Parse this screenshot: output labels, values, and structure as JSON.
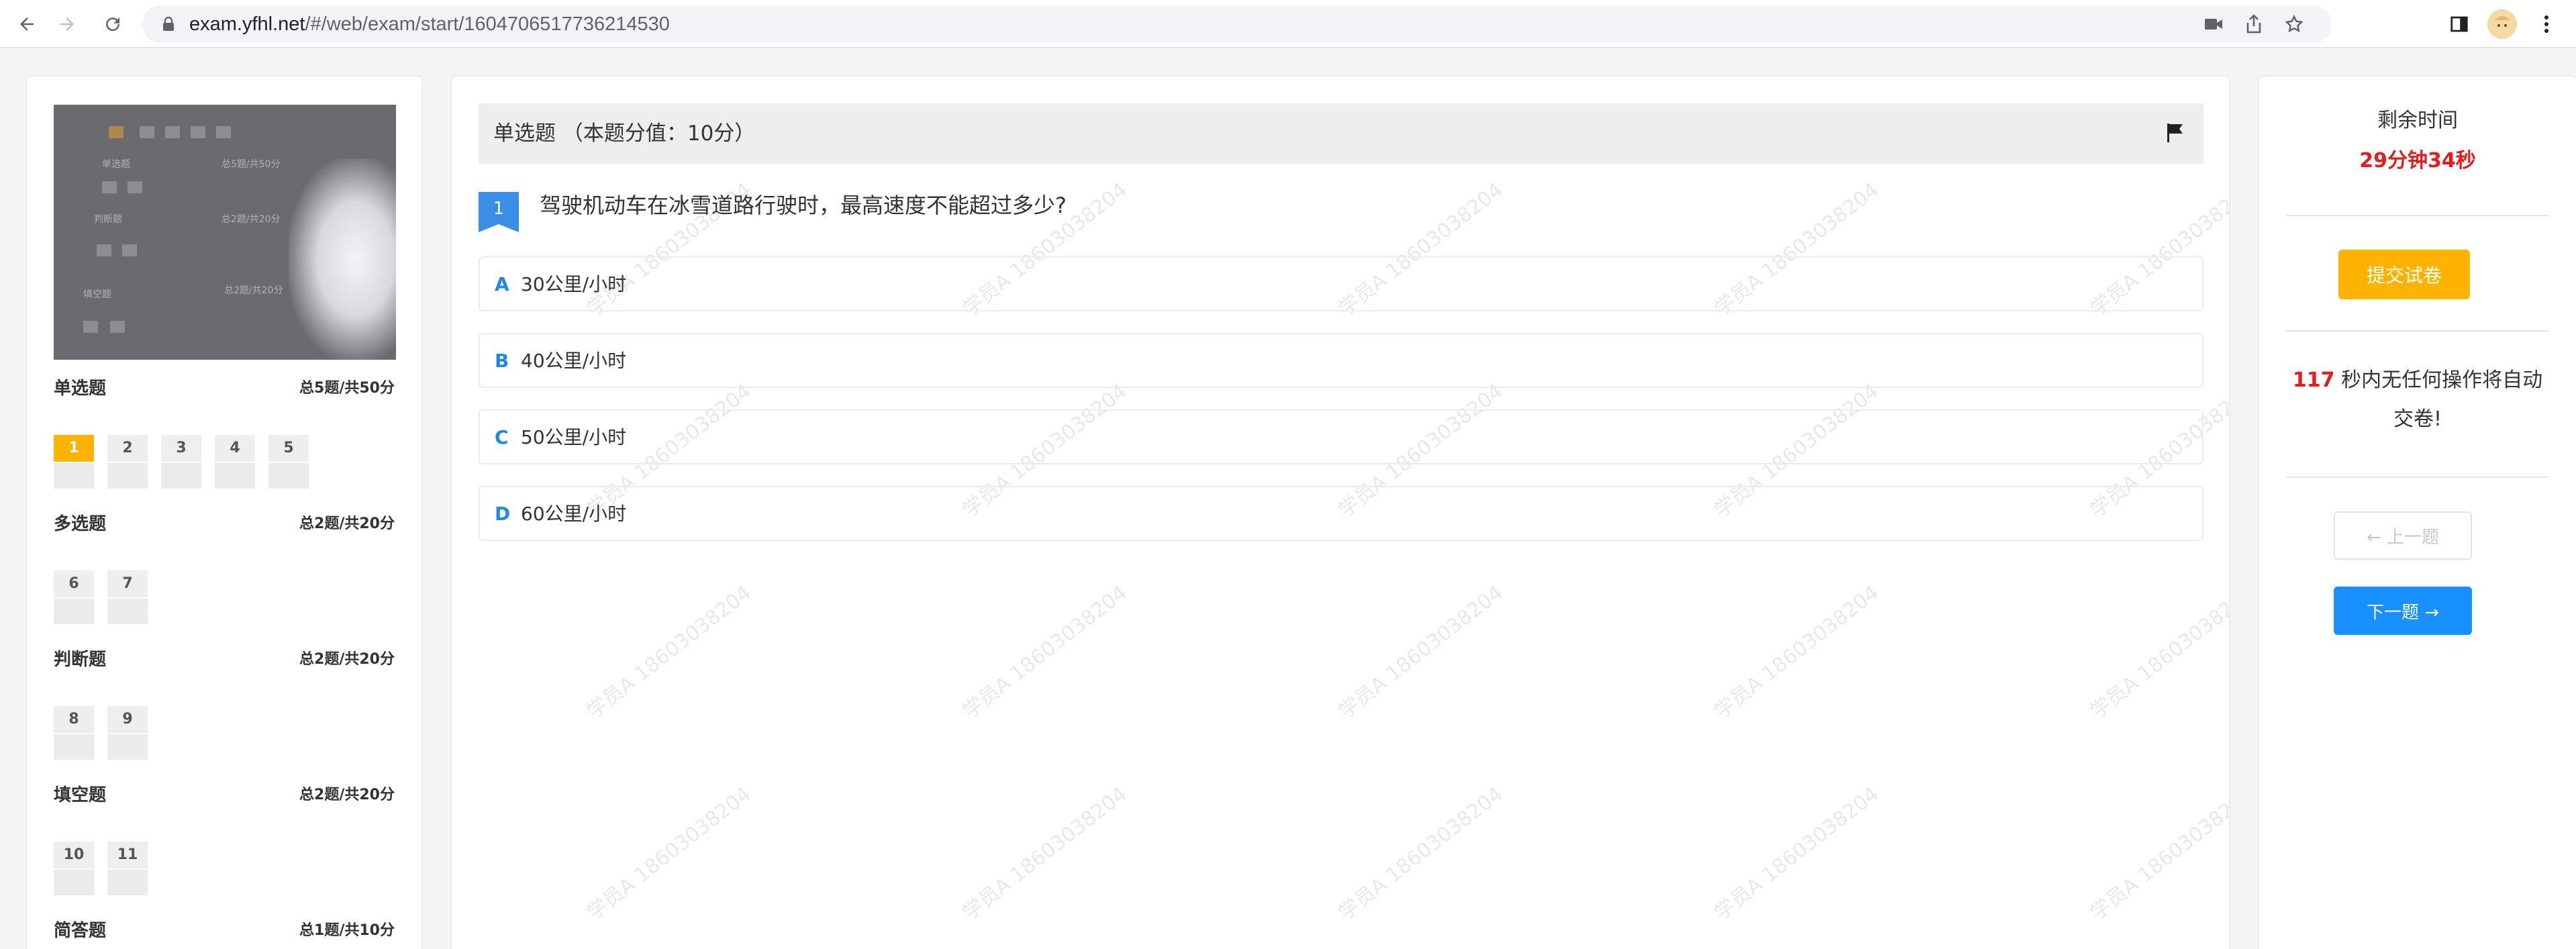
{
  "browser": {
    "url_host": "exam.yfhl.net",
    "url_path": "/#/web/exam/start/1604706517736214530"
  },
  "camera": {
    "blur_labels": [
      "单选题",
      "判断题",
      "填空题",
      "总5题/共50分",
      "总2题/共20分",
      "总2题/共20分"
    ]
  },
  "sections": [
    {
      "title": "单选题",
      "count": "总5题/共50分",
      "questions": [
        "1",
        "2",
        "3",
        "4",
        "5"
      ]
    },
    {
      "title": "多选题",
      "count": "总2题/共20分",
      "questions": [
        "6",
        "7"
      ]
    },
    {
      "title": "判断题",
      "count": "总2题/共20分",
      "questions": [
        "8",
        "9"
      ]
    },
    {
      "title": "填空题",
      "count": "总2题/共20分",
      "questions": [
        "10",
        "11"
      ]
    },
    {
      "title": "简答题",
      "count": "总1题/共10分",
      "questions": []
    }
  ],
  "question": {
    "header": "单选题 （本题分值：10分）",
    "number": "1",
    "text": "驾驶机动车在冰雪道路行驶时，最高速度不能超过多少?",
    "options": [
      {
        "letter": "A",
        "text": "30公里/小时"
      },
      {
        "letter": "B",
        "text": "40公里/小时"
      },
      {
        "letter": "C",
        "text": "50公里/小时"
      },
      {
        "letter": "D",
        "text": "60公里/小时"
      }
    ]
  },
  "watermark": "学员A 18603038204",
  "sidebar": {
    "remaining_label": "剩余时间",
    "remaining_time": "29分钟34秒",
    "submit_label": "提交试卷",
    "auto_count": "117",
    "auto_text": " 秒内无任何操作将自动交卷!",
    "prev_label": "← 上一题",
    "next_label": "下一题 →"
  },
  "colors": {
    "accent_blue": "#1890ff",
    "submit_orange": "#ffb300",
    "active_question": "#ffb300",
    "timer_red": "#e41c1c"
  }
}
